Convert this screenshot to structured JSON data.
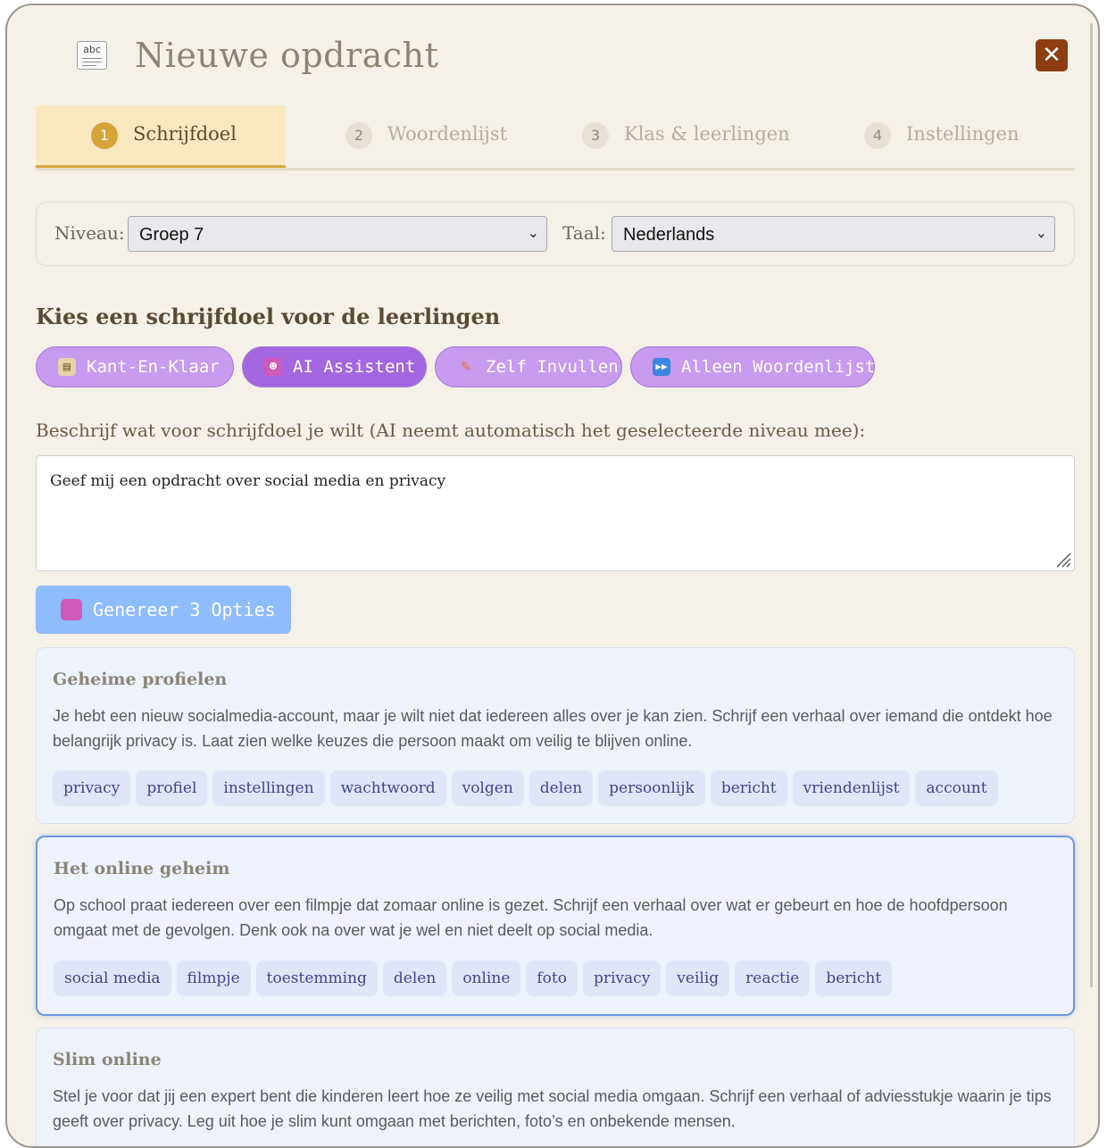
{
  "header": {
    "title": "Nieuwe opdracht",
    "icon": "document-abc-icon",
    "close_icon": "close-icon"
  },
  "steps": [
    {
      "num": "1",
      "label": "Schrijfdoel",
      "active": true
    },
    {
      "num": "2",
      "label": "Woordenlijst",
      "active": false
    },
    {
      "num": "3",
      "label": "Klas & leerlingen",
      "active": false
    },
    {
      "num": "4",
      "label": "Instellingen",
      "active": false
    }
  ],
  "filters": {
    "niveau_label": "Niveau:",
    "niveau_value": "Groep 7",
    "taal_label": "Taal:",
    "taal_value": "Nederlands"
  },
  "section_title": "Kies een schrijfdoel voor de leerlingen",
  "modes": [
    {
      "label": "Kant-En-Klaar",
      "icon": "clipboard-icon",
      "active": false
    },
    {
      "label": "AI Assistent",
      "icon": "robot-icon",
      "active": true
    },
    {
      "label": "Zelf Invullen",
      "icon": "pencil-icon",
      "active": false
    },
    {
      "label": "Alleen Woordenlijst",
      "icon": "fast-forward-icon",
      "active": false
    }
  ],
  "description": {
    "label": "Beschrijf wat voor schrijfdoel je wilt (AI neemt automatisch het geselecteerde niveau mee):",
    "value": "Geef mij een opdracht over social media en privacy"
  },
  "generate_button": {
    "label": "Genereer 3 Opties",
    "icon": "robot-icon"
  },
  "options": [
    {
      "title": "Geheime profielen",
      "description": "Je hebt een nieuw socialmedia-account, maar je wilt niet dat iedereen alles over je kan zien. Schrijf een verhaal over iemand die ontdekt hoe belangrijk privacy is. Laat zien welke keuzes die persoon maakt om veilig te blijven online.",
      "tags": [
        "privacy",
        "profiel",
        "instellingen",
        "wachtwoord",
        "volgen",
        "delen",
        "persoonlijk",
        "bericht",
        "vriendenlijst",
        "account"
      ],
      "selected": false
    },
    {
      "title": "Het online geheim",
      "description": "Op school praat iedereen over een filmpje dat zomaar online is gezet. Schrijf een verhaal over wat er gebeurt en hoe de hoofdpersoon omgaat met de gevolgen. Denk ook na over wat je wel en niet deelt op social media.",
      "tags": [
        "social media",
        "filmpje",
        "toestemming",
        "delen",
        "online",
        "foto",
        "privacy",
        "veilig",
        "reactie",
        "bericht"
      ],
      "selected": true
    },
    {
      "title": "Slim online",
      "description": "Stel je voor dat jij een expert bent die kinderen leert hoe ze veilig met social media omgaan. Schrijf een verhaal of adviesstukje waarin je tips geeft over privacy. Leg uit hoe je slim kunt omgaan met berichten, foto’s en onbekende mensen.",
      "tags": [],
      "selected": false
    }
  ],
  "colors": {
    "accent": "#d4a43b",
    "mode_button": "#c89af0",
    "mode_active": "#a466e0",
    "generate": "#8ebcfc",
    "close": "#8b3e0f"
  }
}
